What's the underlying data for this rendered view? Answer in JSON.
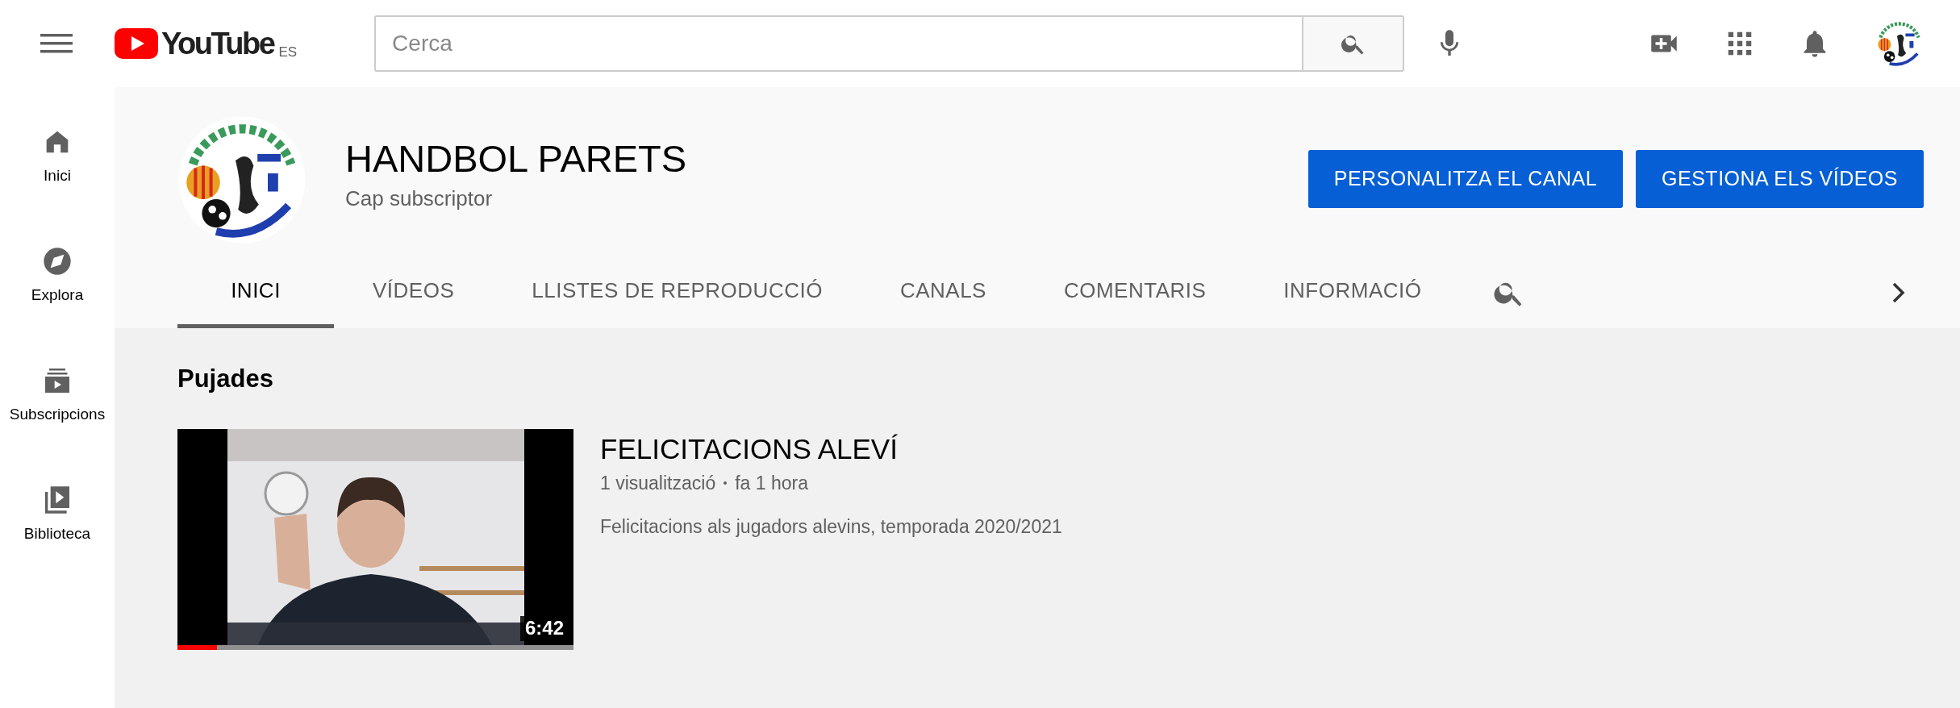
{
  "header": {
    "logo": "YouTube",
    "region": "ES",
    "search": {
      "placeholder": "Cerca"
    }
  },
  "sidebar": {
    "items": [
      {
        "label": "Inici",
        "kind": "home"
      },
      {
        "label": "Explora",
        "kind": "explore"
      },
      {
        "label": "Subscripcions",
        "kind": "subscriptions"
      },
      {
        "label": "Biblioteca",
        "kind": "library"
      }
    ]
  },
  "channel": {
    "name": "HANDBOL PARETS",
    "subscribers": "Cap subscriptor",
    "buttons": [
      "PERSONALITZA EL CANAL",
      "GESTIONA ELS VÍDEOS"
    ],
    "tabs": [
      {
        "label": "INICI",
        "selected": true
      },
      {
        "label": "VÍDEOS",
        "selected": false
      },
      {
        "label": "LLISTES DE REPRODUCCIÓ",
        "selected": false
      },
      {
        "label": "CANALS",
        "selected": false
      },
      {
        "label": "COMENTARIS",
        "selected": false
      },
      {
        "label": "INFORMACIÓ",
        "selected": false
      }
    ]
  },
  "section": {
    "title": "Pujades",
    "video": {
      "kind": "picture",
      "title": "FELICITACIONS ALEVÍ",
      "views": "1 visualització",
      "age": "fa 1 hora",
      "description": "Felicitacions als jugadors alevins, temporada 2020/2021",
      "duration": "6:42",
      "watch_progress": {
        "level": 0.1
      }
    }
  }
}
